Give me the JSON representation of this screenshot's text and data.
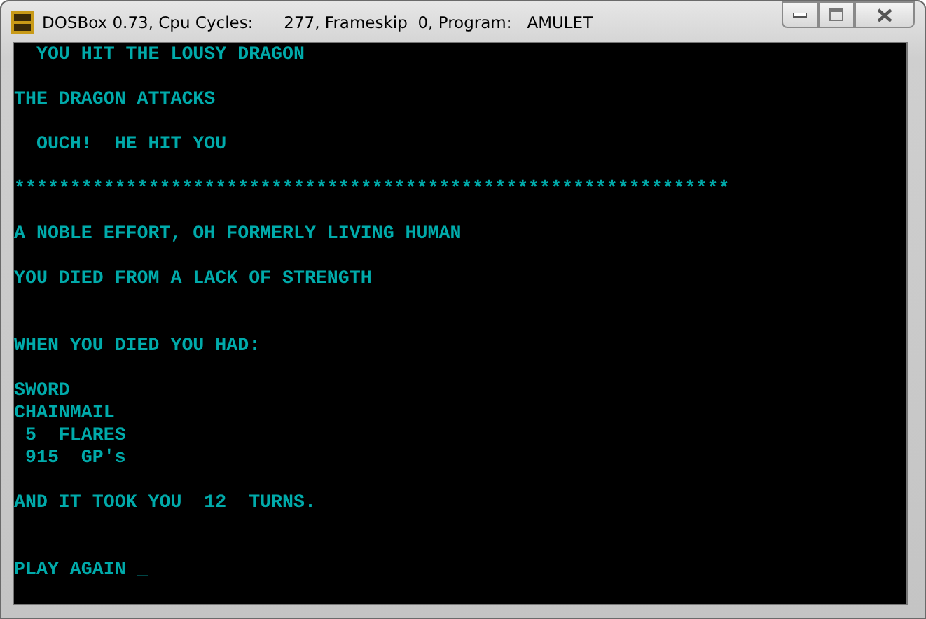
{
  "window": {
    "title": "DOSBox 0.73, Cpu Cycles:      277, Frameskip  0, Program:   AMULET"
  },
  "screen": {
    "lines": [
      {
        "text": "  YOU HIT THE LOUSY DRAGON"
      },
      {
        "text": "THE DRAGON ATTACKS"
      },
      {
        "text": "  OUCH!  HE HIT YOU"
      },
      {
        "text": "****************************************************************"
      },
      {
        "text": "A NOBLE EFFORT, OH FORMERLY LIVING HUMAN"
      },
      {
        "text": "YOU DIED FROM A LACK OF STRENGTH"
      },
      {
        "text": "WHEN YOU DIED YOU HAD:"
      },
      {
        "text": "SWORD"
      },
      {
        "text": "CHAINMAIL"
      },
      {
        "text": " 5  FLARES"
      },
      {
        "text": " 915  GP's"
      },
      {
        "text": "AND IT TOOK YOU  12  TURNS."
      },
      {
        "text": "PLAY AGAIN _"
      }
    ]
  }
}
